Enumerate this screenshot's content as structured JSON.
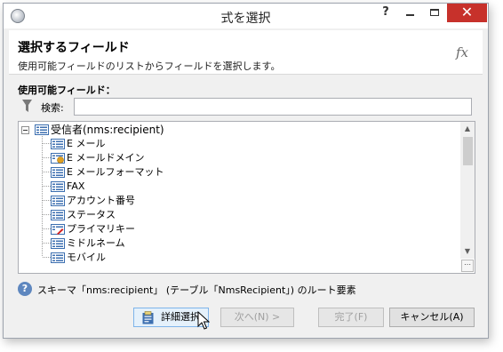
{
  "window": {
    "title": "式を選択",
    "help_glyph": "?",
    "close_glyph": "✕"
  },
  "header": {
    "title": "選択するフィールド",
    "subtitle": "使用可能フィールドのリストからフィールドを選択します。",
    "fx_label": "fx"
  },
  "fields": {
    "label": "使用可能フィールド：",
    "search_label": "検索:",
    "search_value": ""
  },
  "tree": {
    "root": {
      "label": "受信者(nms:recipient)",
      "icon": "table-list-icon",
      "expanded": true
    },
    "items": [
      {
        "label": "E メール",
        "icon": "field-icon"
      },
      {
        "label": "E メールドメイン",
        "icon": "computed-field-icon"
      },
      {
        "label": "E メールフォーマット",
        "icon": "field-icon"
      },
      {
        "label": "FAX",
        "icon": "field-icon"
      },
      {
        "label": "アカウント番号",
        "icon": "field-icon"
      },
      {
        "label": "ステータス",
        "icon": "field-icon"
      },
      {
        "label": "プライマリキー",
        "icon": "primary-key-icon"
      },
      {
        "label": "ミドルネーム",
        "icon": "field-icon"
      },
      {
        "label": "モバイル",
        "icon": "field-icon"
      }
    ],
    "corner_glyph": "⋯"
  },
  "status": {
    "text": "スキーマ「nms:recipient」 (テーブル「NmsRecipient」) のルート要素",
    "icon": "info-icon"
  },
  "buttons": {
    "detail": "詳細選択",
    "next": "次へ(N) >",
    "finish": "完了(F)",
    "cancel": "キャンセル(A)"
  },
  "colors": {
    "close_button": "#c7312b",
    "field_icon": "#3c6fb0",
    "primary_key_mark": "#d62020",
    "computed_mark": "#e0a020"
  }
}
